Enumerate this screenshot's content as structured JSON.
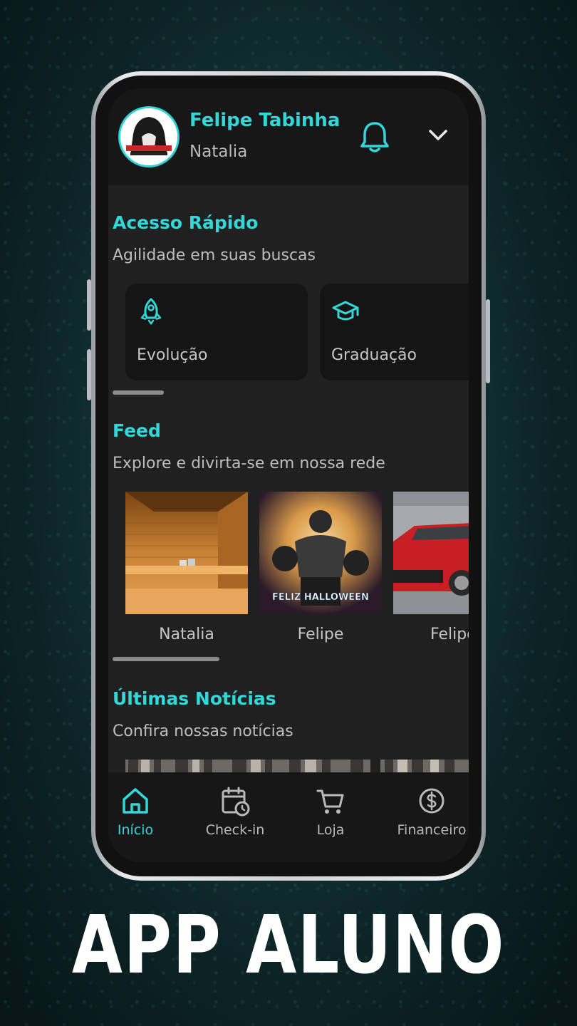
{
  "header": {
    "user_name": "Felipe Tabinha",
    "user_subtitle": "Natalia"
  },
  "quick_access": {
    "title": "Acesso Rápido",
    "subtitle": "Agilidade em suas buscas",
    "items": [
      {
        "label": "Evolução",
        "icon": "rocket-icon"
      },
      {
        "label": "Graduação",
        "icon": "graduation-cap-icon"
      }
    ]
  },
  "feed": {
    "title": "Feed",
    "subtitle": "Explore e divirta-se em nossa rede",
    "items": [
      {
        "label": "Natalia"
      },
      {
        "label": "Felipe",
        "image_text": "FELIZ HALLOWEEN"
      },
      {
        "label": "Felipe"
      }
    ]
  },
  "news": {
    "title": "Últimas Notícias",
    "subtitle": "Confira nossas notícias"
  },
  "nav": {
    "items": [
      {
        "label": "Início",
        "icon": "home-icon",
        "active": true
      },
      {
        "label": "Check-in",
        "icon": "calendar-clock-icon",
        "active": false
      },
      {
        "label": "Loja",
        "icon": "cart-icon",
        "active": false
      },
      {
        "label": "Financeiro",
        "icon": "dollar-icon",
        "active": false
      }
    ]
  },
  "caption": "APP ALUNO",
  "colors": {
    "accent": "#35d6d8",
    "screen_bg": "#202020",
    "header_bg": "#171717"
  }
}
